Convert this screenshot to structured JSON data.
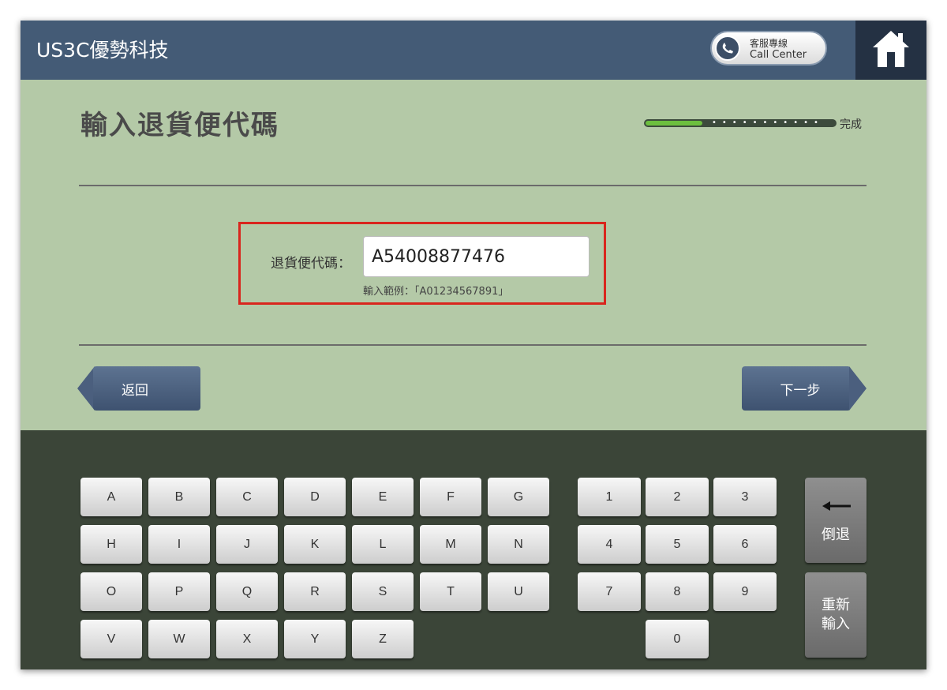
{
  "header": {
    "brand": "US3C優勢科技",
    "call_center_line1": "客服專線",
    "call_center_line2": "Call Center",
    "home_icon": "home-icon",
    "phone_icon": "phone-icon"
  },
  "main": {
    "title": "輸入退貨便代碼",
    "progress": {
      "fraction": 0.3,
      "label": "完成",
      "dots": "•••••••••••"
    },
    "field": {
      "label": "退貨便代碼：",
      "value": "A54008877476",
      "hint": "輸入範例：「A01234567891」"
    },
    "back_label": "返回",
    "next_label": "下一步"
  },
  "keyboard": {
    "letters": [
      "A",
      "B",
      "C",
      "D",
      "E",
      "F",
      "G",
      "H",
      "I",
      "J",
      "K",
      "L",
      "M",
      "N",
      "O",
      "P",
      "Q",
      "R",
      "S",
      "T",
      "U",
      "V",
      "W",
      "X",
      "Y",
      "Z"
    ],
    "digits": [
      "1",
      "2",
      "3",
      "4",
      "5",
      "6",
      "7",
      "8",
      "9",
      "0"
    ],
    "backspace_label": "倒退",
    "reset_label": "重新\n輸入"
  },
  "colors": {
    "header": "#445b76",
    "content": "#b4c9a7",
    "keyboard": "#3b4538",
    "highlight": "#d9251d",
    "progress": "#6cbf3e"
  }
}
